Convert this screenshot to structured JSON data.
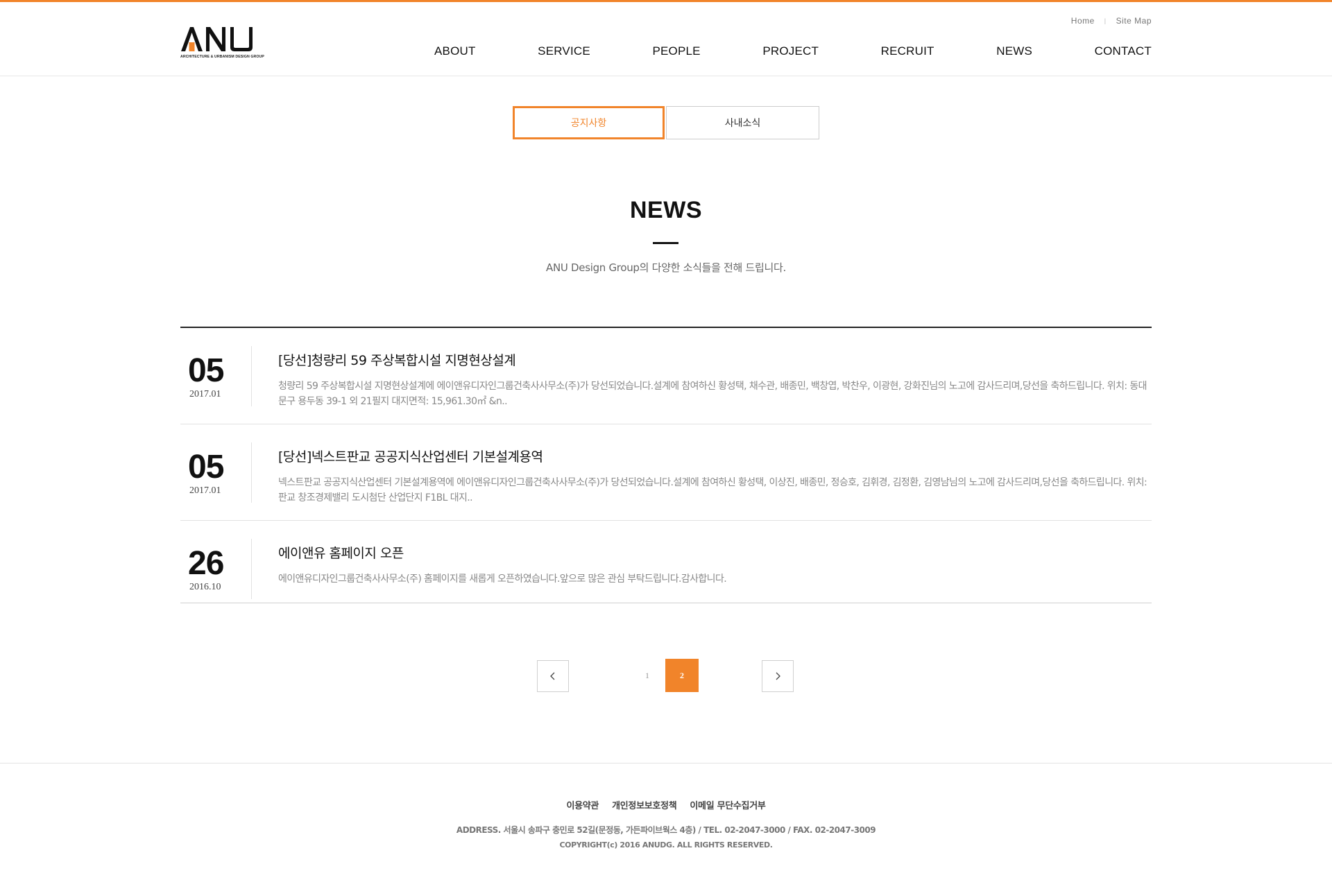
{
  "header": {
    "logo": {
      "text": "ANU",
      "subtitle": "ARCHITECTURE & URBANISM DESIGN GROUP",
      "accent_color": "#f1842a"
    },
    "util_links": [
      "Home",
      "Site Map"
    ],
    "util_separator": "|",
    "nav": [
      "ABOUT",
      "SERVICE",
      "PEOPLE",
      "PROJECT",
      "RECRUIT",
      "NEWS",
      "CONTACT"
    ]
  },
  "tabs": [
    {
      "label": "공지사항",
      "active": true
    },
    {
      "label": "사내소식",
      "active": false
    }
  ],
  "section": {
    "title": "NEWS",
    "description": "ANU Design Group의 다양한 소식들을 전해 드립니다."
  },
  "news": [
    {
      "day": "05",
      "year_month": "2017.01",
      "title": "[당선]청량리 59 주상복합시설 지명현상설계",
      "summary": "청량리 59 주상복합시설 지명현상설계에 에이앤유디자인그룹건축사사무소(주)가 당선되었습니다.설계에 참여하신 황성택, 채수관, 배종민, 백창엽, 박찬우, 이광현, 강화진님의 노고에 감사드리며,당선을 축하드립니다. 위치: 동대문구 용두동 39-1 외 21필지    대지면적: 15,961.30㎡ &n.."
    },
    {
      "day": "05",
      "year_month": "2017.01",
      "title": "[당선]넥스트판교 공공지식산업센터 기본설계용역",
      "summary": "넥스트판교 공공지식산업센터 기본설계용역에 에이앤유디자인그룹건축사사무소(주)가 당선되었습니다.설계에 참여하신 황성택, 이상진, 배종민, 정승호, 김휘경, 김정환, 김영남님의 노고에 감사드리며,당선을 축하드립니다.  위치: 판교 창조경제밸리 도시첨단 산업단지 F1BL    대지.."
    },
    {
      "day": "26",
      "year_month": "2016.10",
      "title": "에이앤유 홈페이지 오픈",
      "summary": "에이앤유디자인그룹건축사사무소(주) 홈페이지를 새롭게 오픈하였습니다.앞으로 많은 관심 부탁드립니다.감사합니다."
    }
  ],
  "pagination": {
    "pages": [
      "1",
      "2"
    ],
    "current": "2",
    "prev_icon": "chevron-left-icon",
    "next_icon": "chevron-right-icon"
  },
  "footer": {
    "links": [
      "이용약관",
      "개인정보보호정책",
      "이메일 무단수집거부"
    ],
    "address": "ADDRESS. 서울시 송파구 충민로 52길(문정동, 가든파이브웍스 4층) / TEL. 02-2047-3000 / FAX. 02-2047-3009",
    "copyright": "COPYRIGHT(c) 2016 ANUDG. ALL RIGHTS RESERVED."
  }
}
